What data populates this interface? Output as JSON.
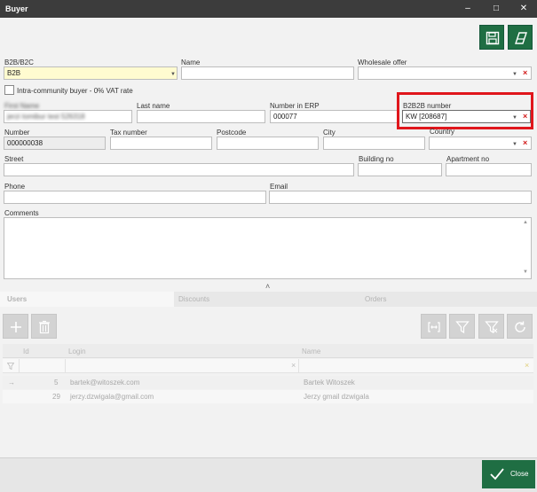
{
  "window": {
    "title": "Buyer",
    "minimize": "–",
    "maximize": "□",
    "close": "✕"
  },
  "toolbar": {
    "save_icon": "floppy-disk-icon",
    "clear_icon": "eraser-icon"
  },
  "form": {
    "b2b_label": "B2B/B2C",
    "b2b_value": "B2B",
    "name_label": "Name",
    "name_value": "",
    "wholesale_label": "Wholesale offer",
    "wholesale_value": "",
    "intra_label": "Intra-community buyer - 0% VAT rate",
    "first_name_label": "First Name",
    "first_name_value": "jerzi tomibur test 526318",
    "last_name_label": "Last name",
    "last_name_value": "",
    "erp_label": "Number in ERP",
    "erp_value": "000077",
    "b2b2b_label": "B2B2B number",
    "b2b2b_value": "KW [208687]",
    "number_label": "Number",
    "number_value": "000000038",
    "tax_label": "Tax number",
    "tax_value": "",
    "postcode_label": "Postcode",
    "postcode_value": "",
    "city_label": "City",
    "city_value": "",
    "country_label": "Country",
    "country_value": "",
    "street_label": "Street",
    "street_value": "",
    "building_label": "Building no",
    "building_value": "",
    "apartment_label": "Apartment no",
    "apartment_value": "",
    "phone_label": "Phone",
    "phone_value": "",
    "email_label": "Email",
    "email_value": "",
    "comments_label": "Comments",
    "comments_value": "",
    "collapse_glyph": "˄"
  },
  "tabs": [
    "Users",
    "Discounts",
    "Orders"
  ],
  "grid": {
    "headers": [
      "Id",
      "Login",
      "Name"
    ],
    "filter_clear": "×",
    "rows": [
      {
        "arrow": "→",
        "id": "5",
        "login": "bartek@witoszek.com",
        "name": "Bartek Witoszek"
      },
      {
        "arrow": "",
        "id": "29",
        "login": "jerzy.dzwigala@gmail.com",
        "name": "Jerzy gmail dzwigala"
      }
    ]
  },
  "footer": {
    "close_label": "Close"
  },
  "colors": {
    "accent": "#1f6e43",
    "titlebar": "#3c3c3c",
    "highlight": "#e0161c",
    "required": "#fffbd0"
  }
}
